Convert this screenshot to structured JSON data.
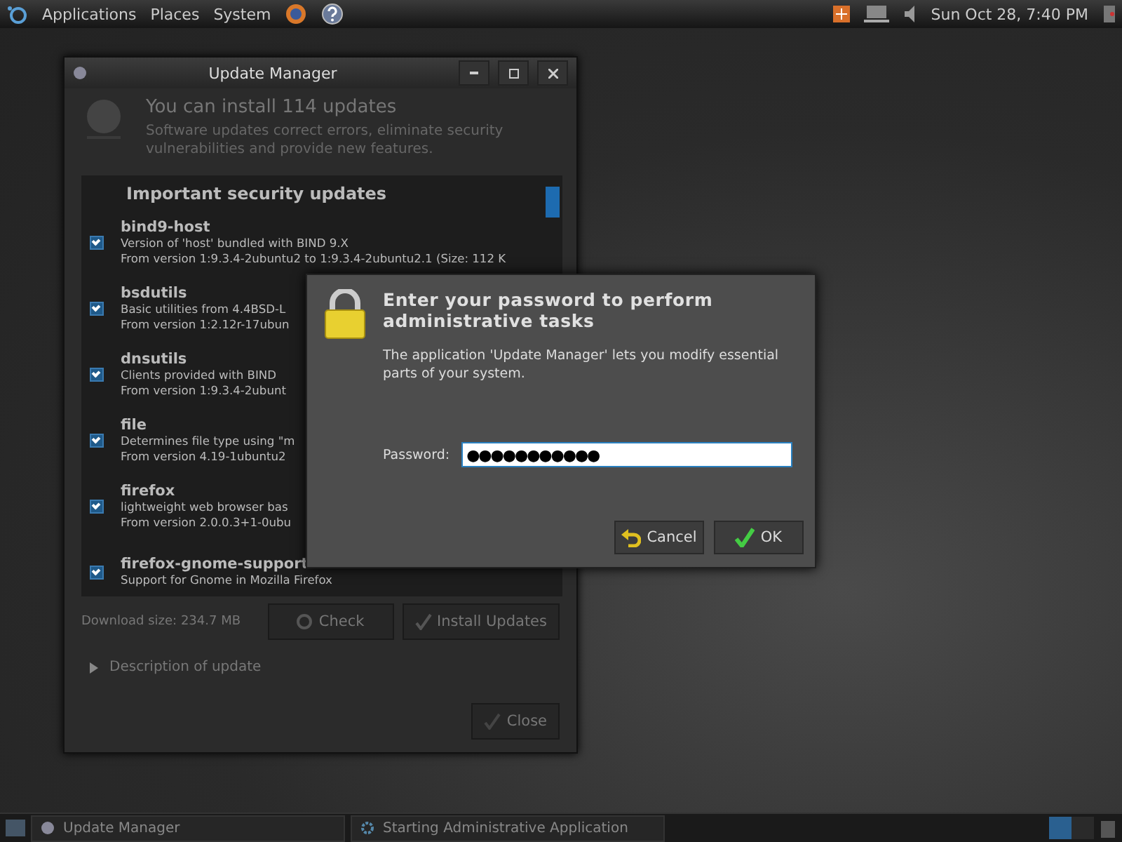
{
  "top_panel": {
    "menus": [
      "Applications",
      "Places",
      "System"
    ],
    "clock": "Sun Oct 28,  7:40 PM"
  },
  "update_manager": {
    "title": "Update Manager",
    "heading": "You can install 114 updates",
    "subtitle": "Software updates correct errors, eliminate security vulnerabilities and provide new features.",
    "section": "Important security updates",
    "updates": [
      {
        "name": "bind9-host",
        "description": "Version of 'host' bundled with BIND 9.X",
        "version": "From version 1:9.3.4-2ubuntu2 to 1:9.3.4-2ubuntu2.1 (Size: 112 K",
        "checked": true
      },
      {
        "name": "bsdutils",
        "description": "Basic utilities from 4.4BSD-L",
        "version": "From version 1:2.12r-17ubun",
        "checked": true
      },
      {
        "name": "dnsutils",
        "description": "Clients provided with BIND",
        "version": "From version 1:9.3.4-2ubunt",
        "checked": true
      },
      {
        "name": "file",
        "description": "Determines file type using \"m",
        "version": "From version 4.19-1ubuntu2",
        "checked": true
      },
      {
        "name": "firefox",
        "description": "lightweight web browser bas",
        "version": "From version 2.0.0.3+1-0ubu",
        "checked": true
      },
      {
        "name": "firefox-gnome-support",
        "description": "Support for Gnome in Mozilla Firefox",
        "checked": true
      }
    ],
    "download_size": "Download size: 234.7 MB",
    "buttons": [
      "Check",
      "Install Updates"
    ],
    "expander": {
      "label": "Description of update",
      "expanded": false
    },
    "close": "Close"
  },
  "auth_dialog": {
    "heading": "Enter your password to perform administrative tasks",
    "message": "The application 'Update Manager' lets you modify essential parts of your system.",
    "password_label": "Password:",
    "password_value": "●●●●●●●●●●●",
    "buttons": [
      "Cancel",
      "OK"
    ]
  },
  "taskbar": {
    "tasks": [
      "Update Manager",
      "Starting Administrative Application"
    ]
  }
}
